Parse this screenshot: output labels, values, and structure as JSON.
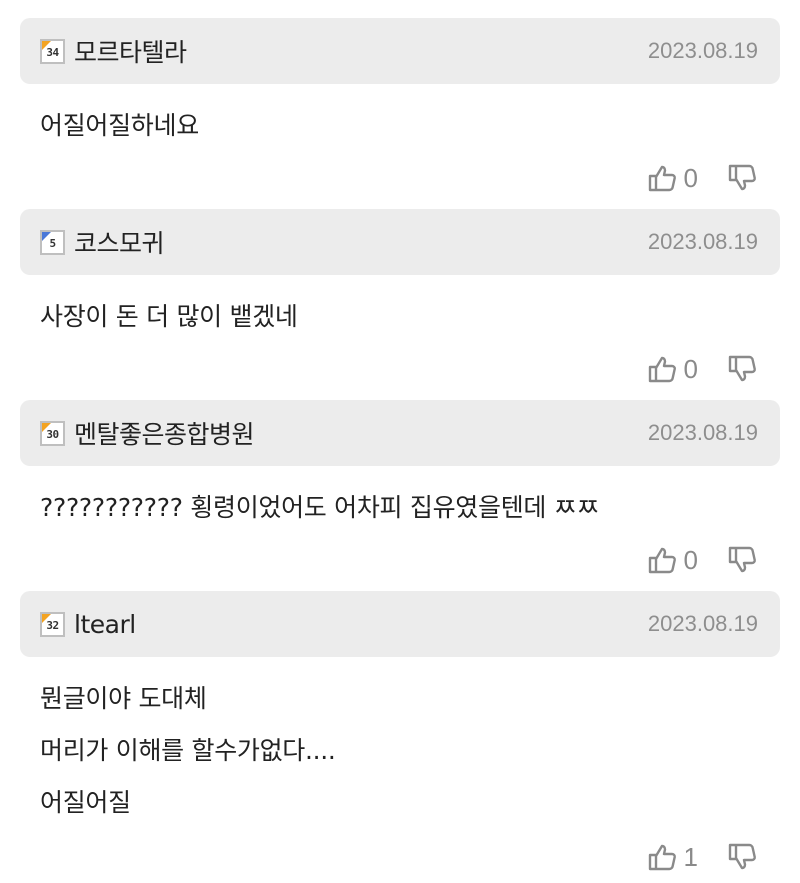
{
  "accent": {
    "orange": "#f3a321",
    "blue": "#4a78d8",
    "header_bg": "#ececec",
    "date": "#8e8e8e"
  },
  "comments": [
    {
      "level": "34",
      "level_color": "#f3a321",
      "nick": "모르타텔라",
      "date": "2023.08.19",
      "lines": [
        "어질어질하네요"
      ],
      "likes": "0"
    },
    {
      "level": "5",
      "level_color": "#4a78d8",
      "nick": "코스모귀",
      "date": "2023.08.19",
      "lines": [
        "사장이 돈 더 많이 뱉겠네"
      ],
      "likes": "0"
    },
    {
      "level": "30",
      "level_color": "#f3a321",
      "nick": "멘탈좋은종합병원",
      "date": "2023.08.19",
      "lines": [
        "??????????? 횡령이었어도 어차피 집유였을텐데 ㅉㅉ"
      ],
      "likes": "0"
    },
    {
      "level": "32",
      "level_color": "#f3a321",
      "nick": "ltearl",
      "date": "2023.08.19",
      "lines": [
        "뭔글이야 도대체",
        "머리가 이해를 할수가없다....",
        "어질어질"
      ],
      "likes": "1"
    }
  ],
  "icons": {
    "like": "thumbs-up-icon",
    "dislike": "thumbs-down-icon"
  }
}
